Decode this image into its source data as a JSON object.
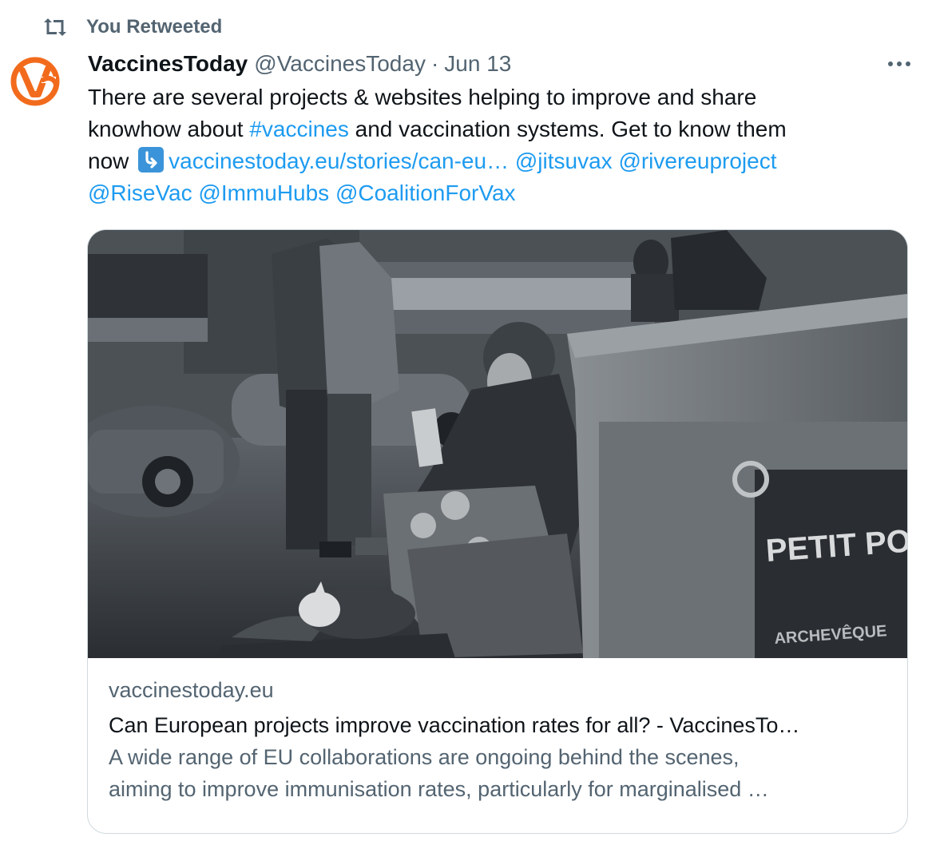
{
  "retweet": {
    "label": "You Retweeted",
    "icon": "retweet-icon"
  },
  "tweet": {
    "author_name": "VaccinesToday",
    "author_handle": "@VaccinesToday",
    "separator": "·",
    "date": "Jun 13",
    "more_icon": "more-dots-icon",
    "text": {
      "line1": "There are several projects & websites helping to improve and share",
      "line2_prefix": "knowhow about ",
      "hashtag": "#vaccines",
      "line2_suffix": " and vaccination systems. Get to know them",
      "line3_prefix": "now ",
      "emoji_icon": "arrow-down-right-emoji-icon",
      "url": "vaccinestoday.eu/stories/can-eu…",
      "mentions_line3": [
        "@jitsuvax",
        "@rivereuproject"
      ],
      "mentions_line4": [
        "@RiseVac",
        "@ImmuHubs",
        "@CoalitionForVax"
      ]
    }
  },
  "card": {
    "image_sign_text": "PETIT PONT",
    "image_sign_sub": "ARCHEVÊQUE",
    "domain": "vaccinestoday.eu",
    "title": "Can European projects improve vaccination rates for all? - VaccinesTo…",
    "description_line1": "A wide range of EU collaborations are ongoing behind the scenes,",
    "description_line2": "aiming to improve immunisation rates, particularly for marginalised …"
  },
  "colors": {
    "link": "#1d9bf0",
    "secondary_text": "#536471",
    "primary_text": "#0f1419",
    "border": "#cfd9de",
    "avatar_orange": "#f26b1d"
  }
}
